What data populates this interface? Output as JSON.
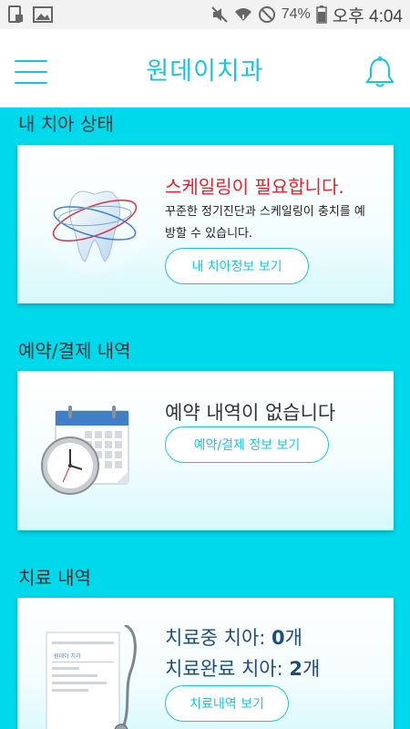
{
  "status_bar": {
    "battery": "74%",
    "time": "오후 4:04"
  },
  "app_bar": {
    "title": "원데이치과"
  },
  "sections": {
    "tooth": {
      "title": "내 치아 상태",
      "headline": "스케일링이 필요합니다.",
      "desc_line1": "꾸준한 정기진단과 스케일링이 충치를 예",
      "desc_line2": "방할 수 있습니다.",
      "button": "내 치아정보 보기"
    },
    "reservation": {
      "title": "예약/결제 내역",
      "headline": "예약 내역이 없습니다",
      "button": "예약/결제 정보 보기"
    },
    "treatment": {
      "title": "치료 내역",
      "in_progress_label": "치료중 치아: ",
      "in_progress_count": "0",
      "in_progress_unit": "개",
      "completed_label": "치료완료 치아: ",
      "completed_count": "2",
      "completed_unit": "개",
      "button": "치료내역 보기",
      "chart_header": "원데이 치과"
    }
  },
  "colors": {
    "accent": "#1ac3df",
    "background": "#00d9ec",
    "alert": "#e8202a",
    "treatment_text": "#1e4d7c"
  }
}
